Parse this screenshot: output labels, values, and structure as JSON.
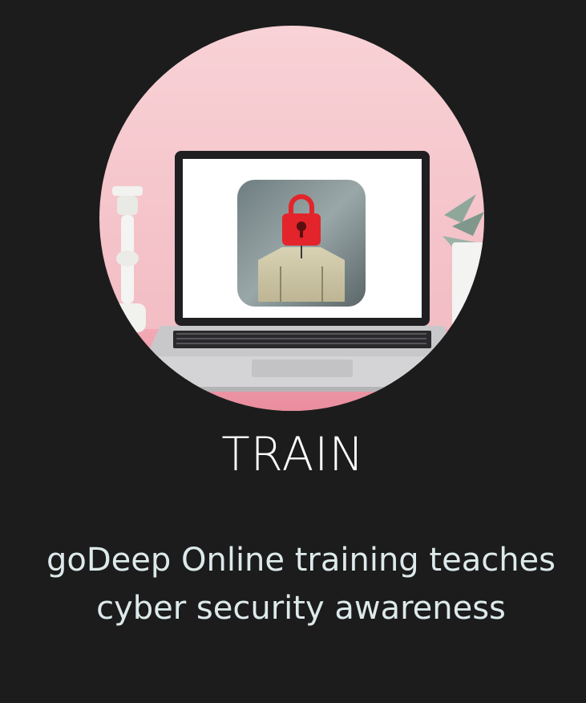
{
  "card": {
    "heading": "TRAIN",
    "description_lines": [
      "goDeep Online training teaches",
      "cyber security awareness"
    ]
  },
  "image": {
    "subject": "laptop-with-padlock-user-icon",
    "icons": [
      "padlock-icon",
      "user-silhouette-icon"
    ]
  },
  "colors": {
    "background": "#1c1c1c",
    "heading": "#ffffff",
    "description": "#dde9ea",
    "wall": "#f4c3c9",
    "padlock": "#e3242b"
  }
}
